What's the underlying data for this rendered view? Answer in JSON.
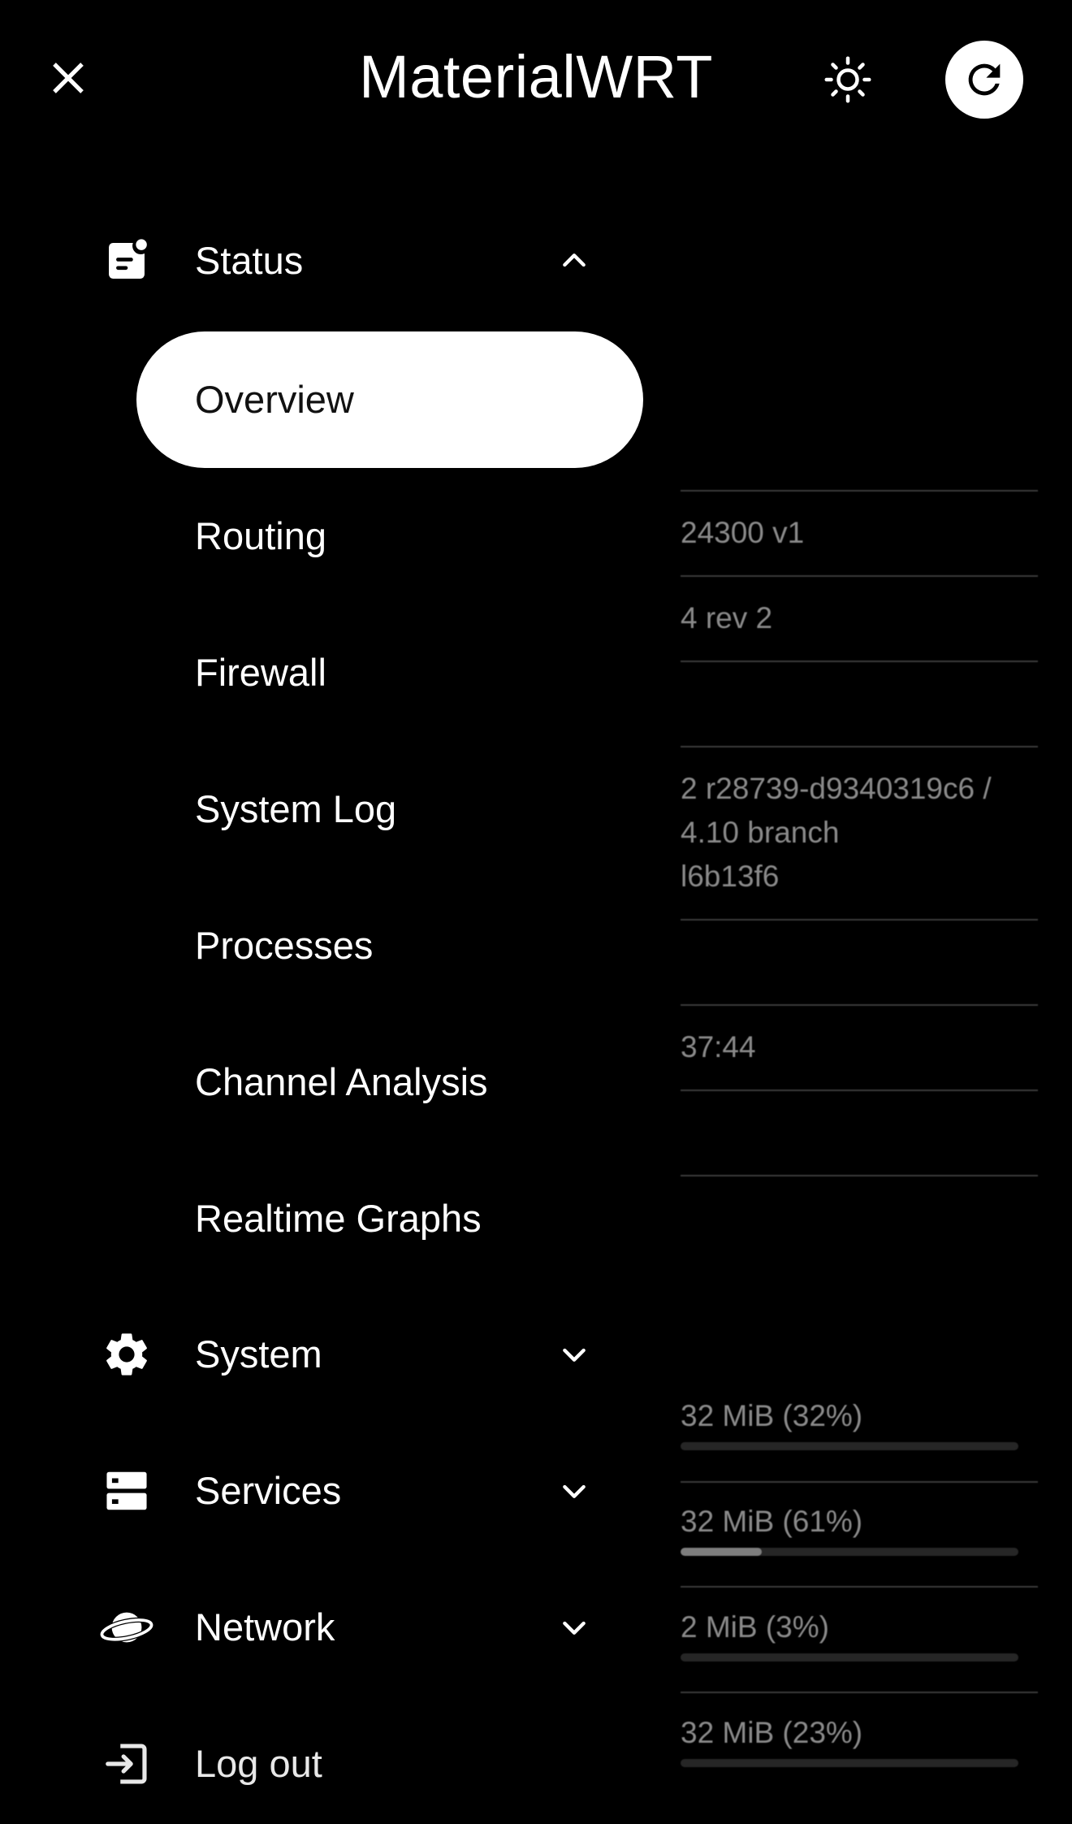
{
  "header": {
    "title": "MaterialWRT",
    "close_icon": "close-icon",
    "theme_icon": "brightness-icon",
    "refresh_icon": "refresh-icon"
  },
  "colors": {
    "background": "#000000",
    "active_item_bg": "#ffffff",
    "active_item_text": "#111111",
    "text": "#ffffff",
    "dim_text": "#8a8a8a"
  },
  "drawer": {
    "status": {
      "label": "Status",
      "icon": "status-icon",
      "expanded": true,
      "items": [
        {
          "label": "Overview",
          "active": true
        },
        {
          "label": "Routing",
          "active": false
        },
        {
          "label": "Firewall",
          "active": false
        },
        {
          "label": "System Log",
          "active": false
        },
        {
          "label": "Processes",
          "active": false
        },
        {
          "label": "Channel Analysis",
          "active": false
        },
        {
          "label": "Realtime Graphs",
          "active": false
        }
      ]
    },
    "system": {
      "label": "System",
      "icon": "gear-icon",
      "expanded": false
    },
    "services": {
      "label": "Services",
      "icon": "services-icon",
      "expanded": false
    },
    "network": {
      "label": "Network",
      "icon": "network-icon",
      "expanded": false
    },
    "logout": {
      "label": "Log out",
      "icon": "logout-icon"
    }
  },
  "background": {
    "model": "24300 v1",
    "architecture": "4 rev 2",
    "firmware_line1": "2 r28739-d9340319c6 /",
    "firmware_line2": "4.10 branch",
    "firmware_line3": "l6b13f6",
    "local_time": "37:44",
    "memory": [
      {
        "text": "32 MiB (32%)",
        "percent": 0
      },
      {
        "text": "32 MiB (61%)",
        "percent": 24
      },
      {
        "text": "2 MiB (3%)",
        "percent": 0
      },
      {
        "text": "32 MiB (23%)",
        "percent": 0
      }
    ]
  }
}
